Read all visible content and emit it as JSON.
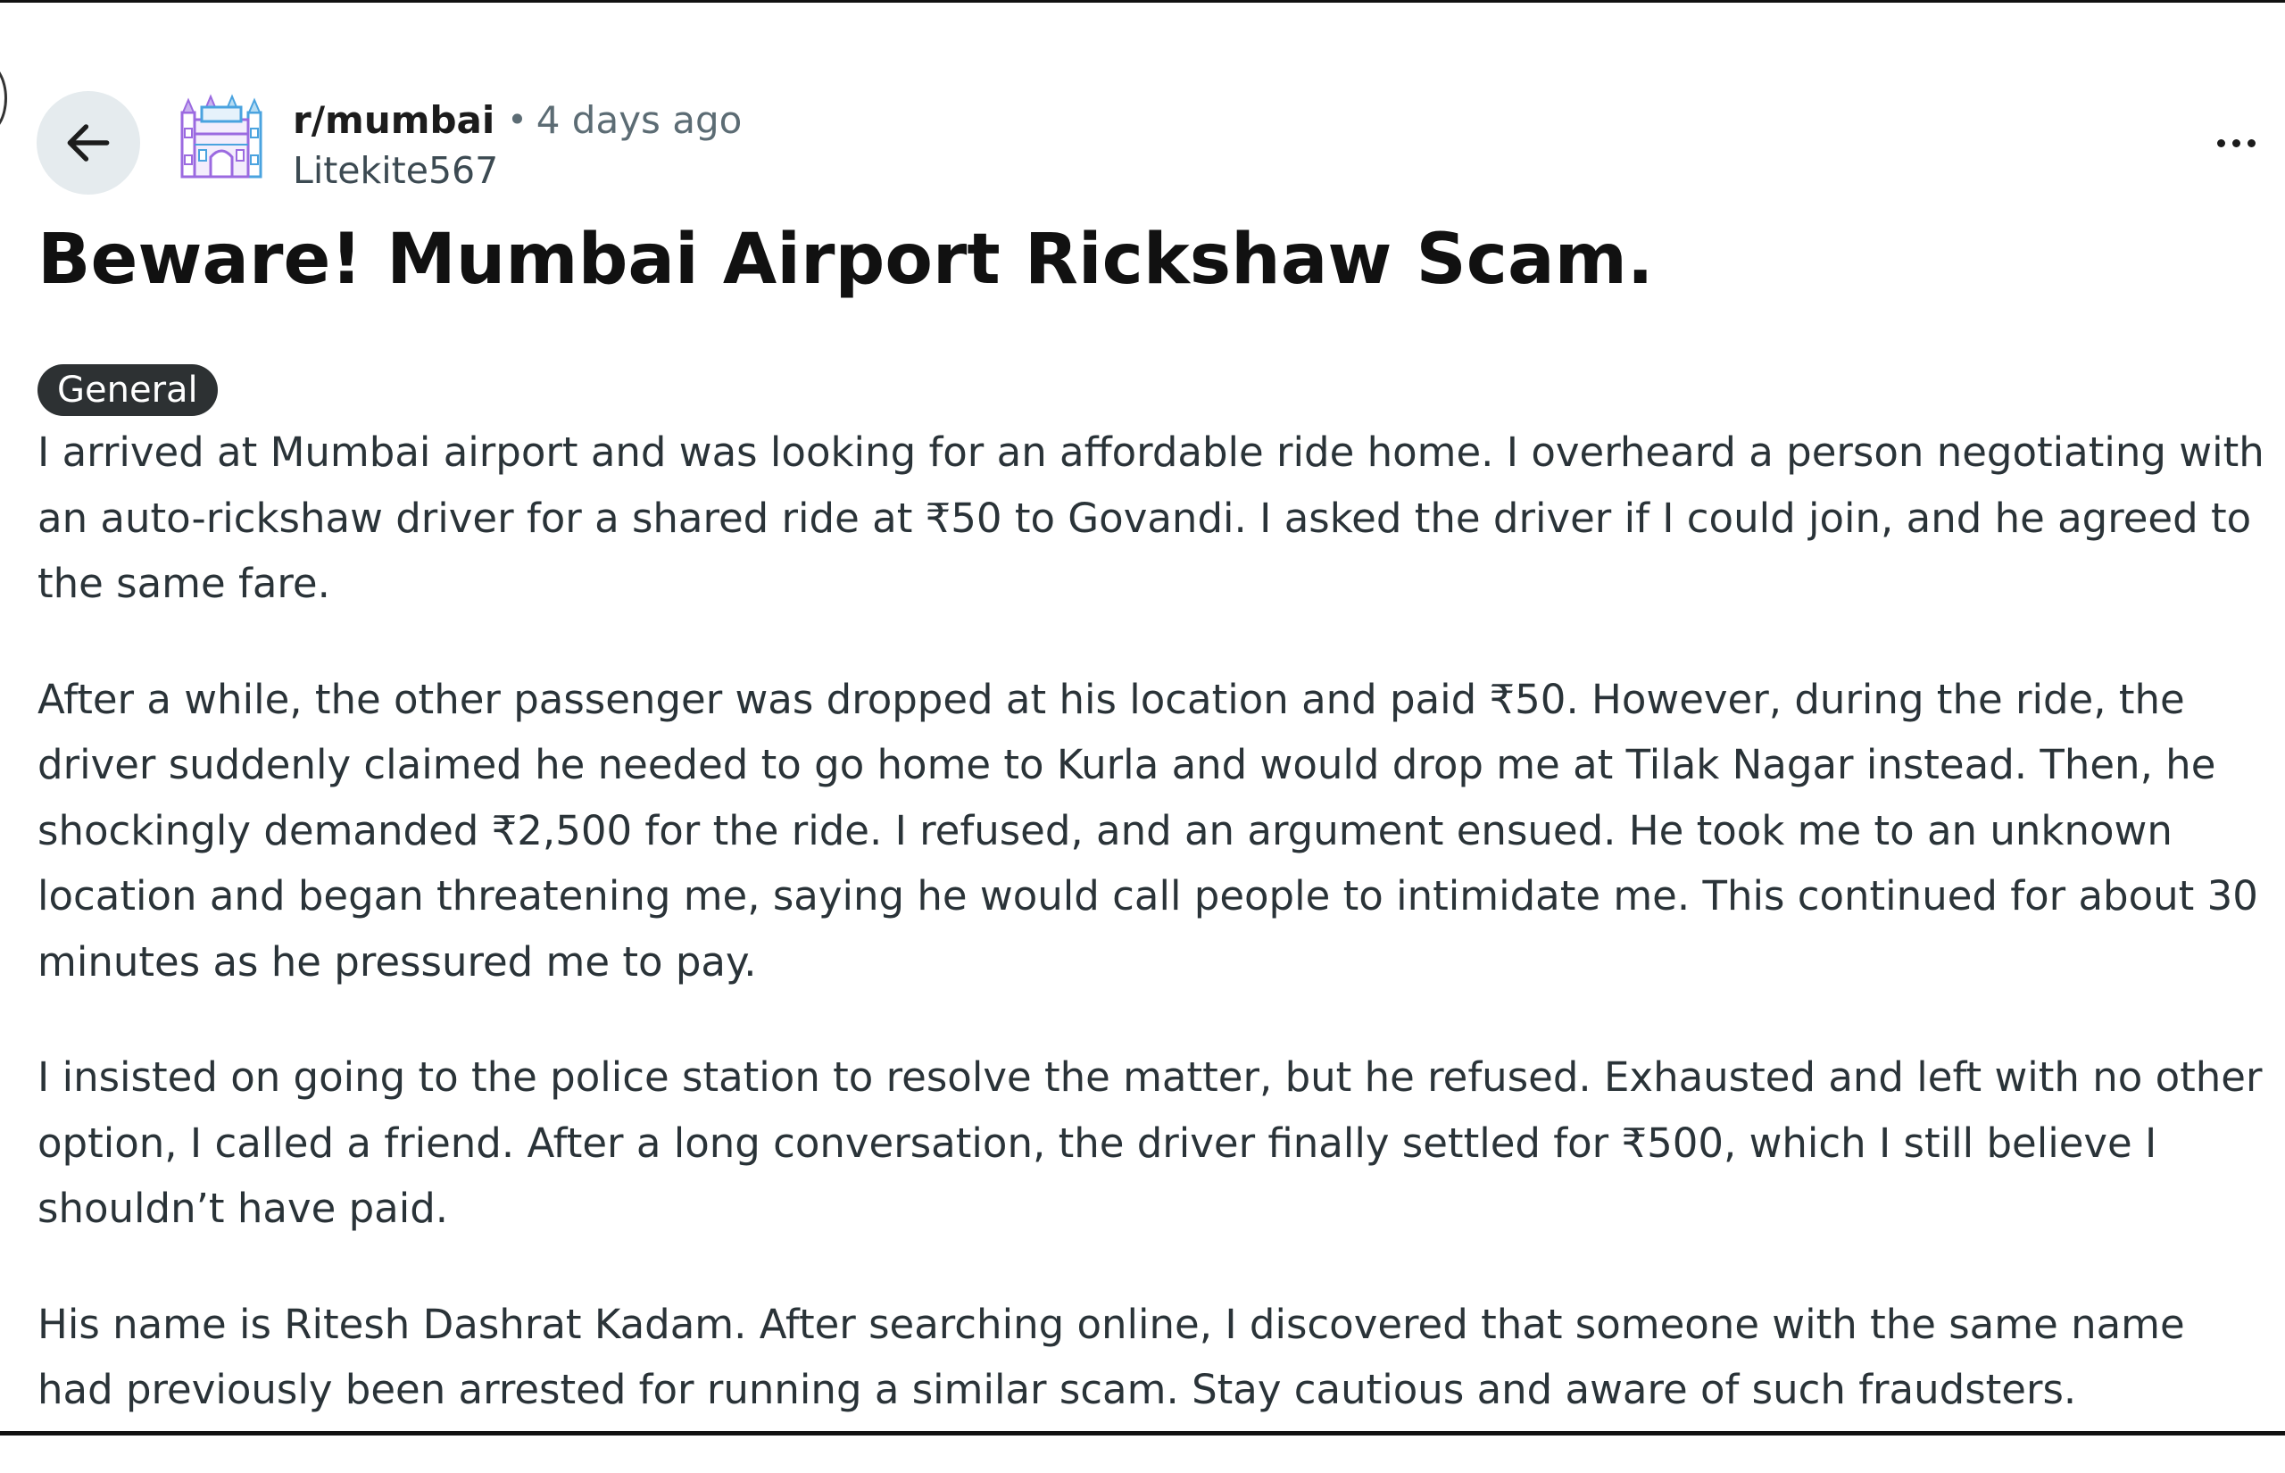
{
  "post": {
    "subreddit": "r/mumbai",
    "separator": "•",
    "time_ago": "4 days ago",
    "author": "Litekite567",
    "title": "Beware! Mumbai Airport Rickshaw Scam.",
    "flair": "General",
    "paragraphs": [
      "I arrived at Mumbai airport and was looking for an affordable ride home. I overheard a person negotiating with an auto-rickshaw driver for a shared ride at ₹50 to Govandi. I asked the driver if I could join, and he agreed to the same fare.",
      "After a while, the other passenger was dropped at his location and paid ₹50. However, during the ride, the driver suddenly claimed he needed to go home to Kurla and would drop me at Tilak Nagar instead. Then, he shockingly demanded ₹2,500 for the ride. I refused, and an argument ensued. He took me to an unknown location and began threatening me, saying he would call people to intimidate me. This continued for about 30 minutes as he pressured me to pay.",
      "I insisted on going to the police station to resolve the matter, but he refused. Exhausted and left with no other option, I called a friend. After a long conversation, the driver finally settled for ₹500, which I still believe I shouldn’t have paid.",
      "His name is Ritesh Dashrat Kadam. After searching online, I discovered that someone with the same name had previously been arrested for running a similar scam. Stay cautious and aware of such fraudsters."
    ]
  },
  "icons": {
    "back": "arrow-left-icon",
    "subreddit_avatar": "gateway-of-india-icon",
    "more": "more-horizontal-icon"
  },
  "colors": {
    "back_button_bg": "#e5ebee",
    "flair_bg": "#2d3133",
    "flair_text": "#ffffff",
    "avatar_purple": "#9b6ae0",
    "avatar_blue": "#4aa3df",
    "meta_gray": "#5c6c74"
  }
}
